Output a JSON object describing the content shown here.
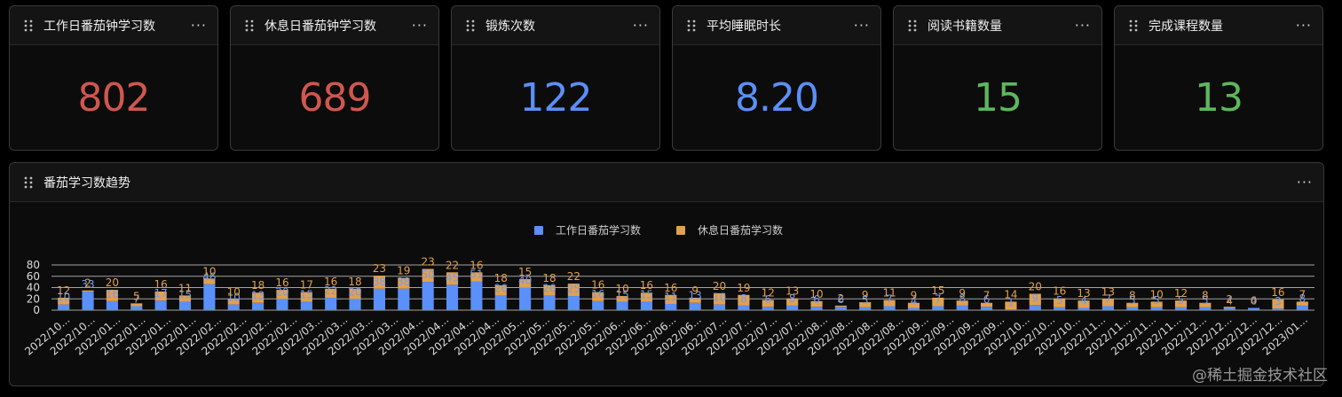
{
  "cards": [
    {
      "title": "工作日番茄钟学习数",
      "value": "802",
      "color": "#d0574f"
    },
    {
      "title": "休息日番茄钟学习数",
      "value": "689",
      "color": "#d0574f"
    },
    {
      "title": "锻炼次数",
      "value": "122",
      "color": "#5b8ff9"
    },
    {
      "title": "平均睡眠时长",
      "value": "8.20",
      "color": "#5b8ff9"
    },
    {
      "title": "阅读书籍数量",
      "value": "15",
      "color": "#5cb85c"
    },
    {
      "title": "完成课程数量",
      "value": "13",
      "color": "#5cb85c"
    }
  ],
  "more_label": "···",
  "panel": {
    "title": "番茄学习数趋势"
  },
  "watermark": "@稀土掘金技术社区",
  "chart_data": {
    "type": "bar",
    "stacked": true,
    "legend": [
      "工作日番茄学习数",
      "休息日番茄学习数"
    ],
    "legend_position": "top-center",
    "colors": [
      "#5b8ff9",
      "#e3a04d"
    ],
    "ylim": [
      0,
      80
    ],
    "yticks": [
      0,
      20,
      40,
      60,
      80
    ],
    "grid": true,
    "x_tick_labels": [
      "2022/10...",
      "2022/10...",
      "2022/01...",
      "2022/01...",
      "2022/01...",
      "2022/01...",
      "2022/02...",
      "2022/02...",
      "2022/02...",
      "2022/02...",
      "2022/03...",
      "2022/03...",
      "2022/03...",
      "2022/03...",
      "2022/04...",
      "2022/04...",
      "2022/04...",
      "2022/04...",
      "2022/05...",
      "2022/05...",
      "2022/05...",
      "2022/05...",
      "2022/06...",
      "2022/06...",
      "2022/06...",
      "2022/06...",
      "2022/07...",
      "2022/07...",
      "2022/07...",
      "2022/07...",
      "2022/08...",
      "2022/08...",
      "2022/08...",
      "2022/08...",
      "2022/09...",
      "2022/09...",
      "2022/09...",
      "2022/09...",
      "2022/10...",
      "2022/10...",
      "2022/10...",
      "2022/11...",
      "2022/11...",
      "2022/11...",
      "2022/11...",
      "2022/12...",
      "2022/12...",
      "2022/12...",
      "2022/12...",
      "2023/01..."
    ],
    "series": [
      {
        "name": "工作日番茄学习数",
        "values": [
          10,
          33,
          16,
          7,
          17,
          15,
          46,
          10,
          13,
          20,
          15,
          22,
          20,
          38,
          38,
          50,
          45,
          51,
          26,
          40,
          26,
          25,
          16,
          15,
          15,
          11,
          13,
          10,
          8,
          6,
          8,
          6,
          6,
          5,
          7,
          4,
          7,
          8,
          6,
          1,
          9,
          5,
          4,
          7,
          5,
          5,
          5,
          5,
          4,
          4,
          3,
          8
        ]
      },
      {
        "name": "休息日番茄学习数",
        "values": [
          12,
          2,
          20,
          5,
          16,
          11,
          10,
          10,
          18,
          16,
          17,
          16,
          18,
          23,
          19,
          23,
          22,
          16,
          18,
          15,
          18,
          22,
          16,
          10,
          16,
          16,
          9,
          20,
          19,
          12,
          13,
          10,
          2,
          9,
          11,
          9,
          15,
          9,
          7,
          14,
          20,
          16,
          13,
          13,
          8,
          10,
          12,
          8,
          2,
          0,
          16,
          7
        ]
      }
    ]
  }
}
